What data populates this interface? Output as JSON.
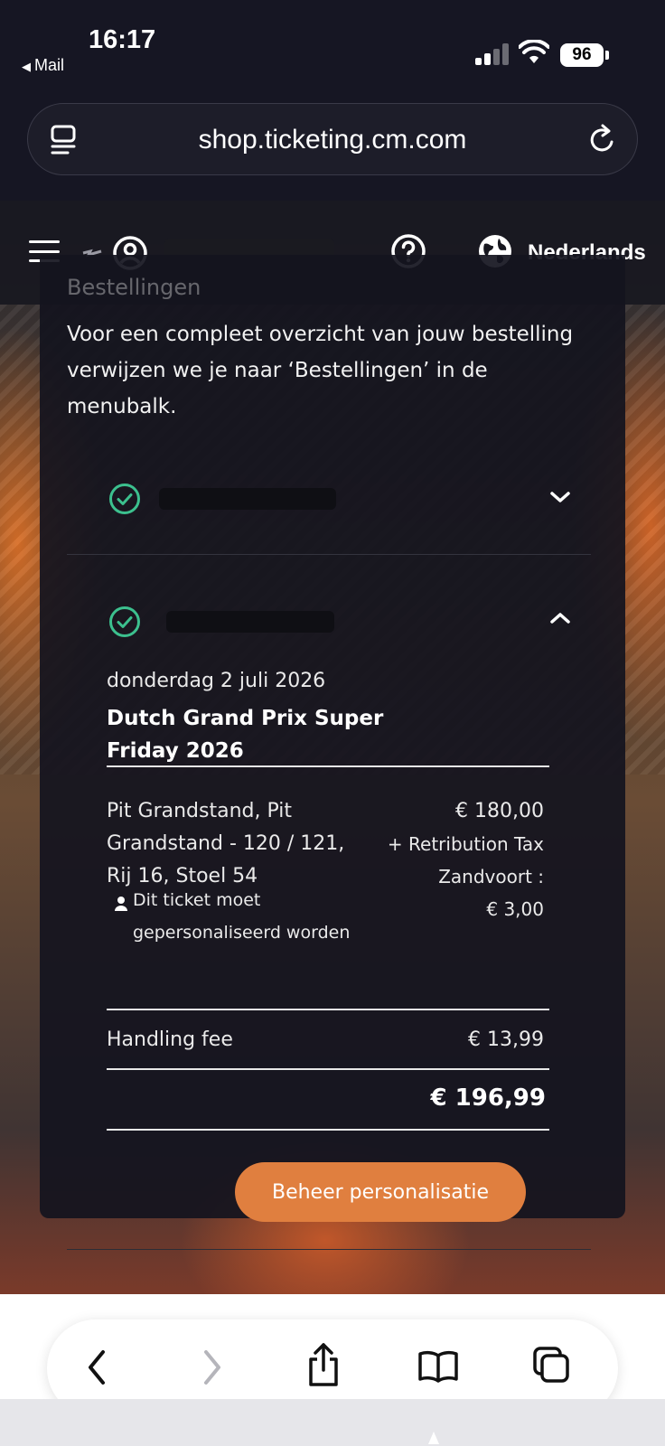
{
  "status_bar": {
    "time": "16:17",
    "back_label": "Mail",
    "battery": "96"
  },
  "browser": {
    "url": "shop.ticketing.cm.com"
  },
  "header": {
    "language": "Nederlands"
  },
  "card": {
    "title": "Bestellingen",
    "intro": "Voor een compleet overzicht van jouw bestelling verwijzen we je naar ‘Bestellingen’ in de menubalk."
  },
  "order": {
    "date": "donderdag 2 juli 2026",
    "event": "Dutch Grand Prix Super Friday 2026",
    "seat": "Pit Grandstand, Pit Grandstand - 120 / 121, Rij 16, Stoel 54",
    "personalisation_note": "Dit ticket moet gepersonaliseerd worden",
    "price": "€ 180,00",
    "tax_note": "+ Retribution Tax Zandvoort :",
    "tax_value": "€ 3,00",
    "handling_fee_label": "Handling fee",
    "handling_fee_value": "€ 13,99",
    "total": "€ 196,99",
    "manage_button": "Beheer personalisatie"
  },
  "colors": {
    "accent": "#e07f3f",
    "check": "#3cc08e",
    "background": "#15151f"
  }
}
